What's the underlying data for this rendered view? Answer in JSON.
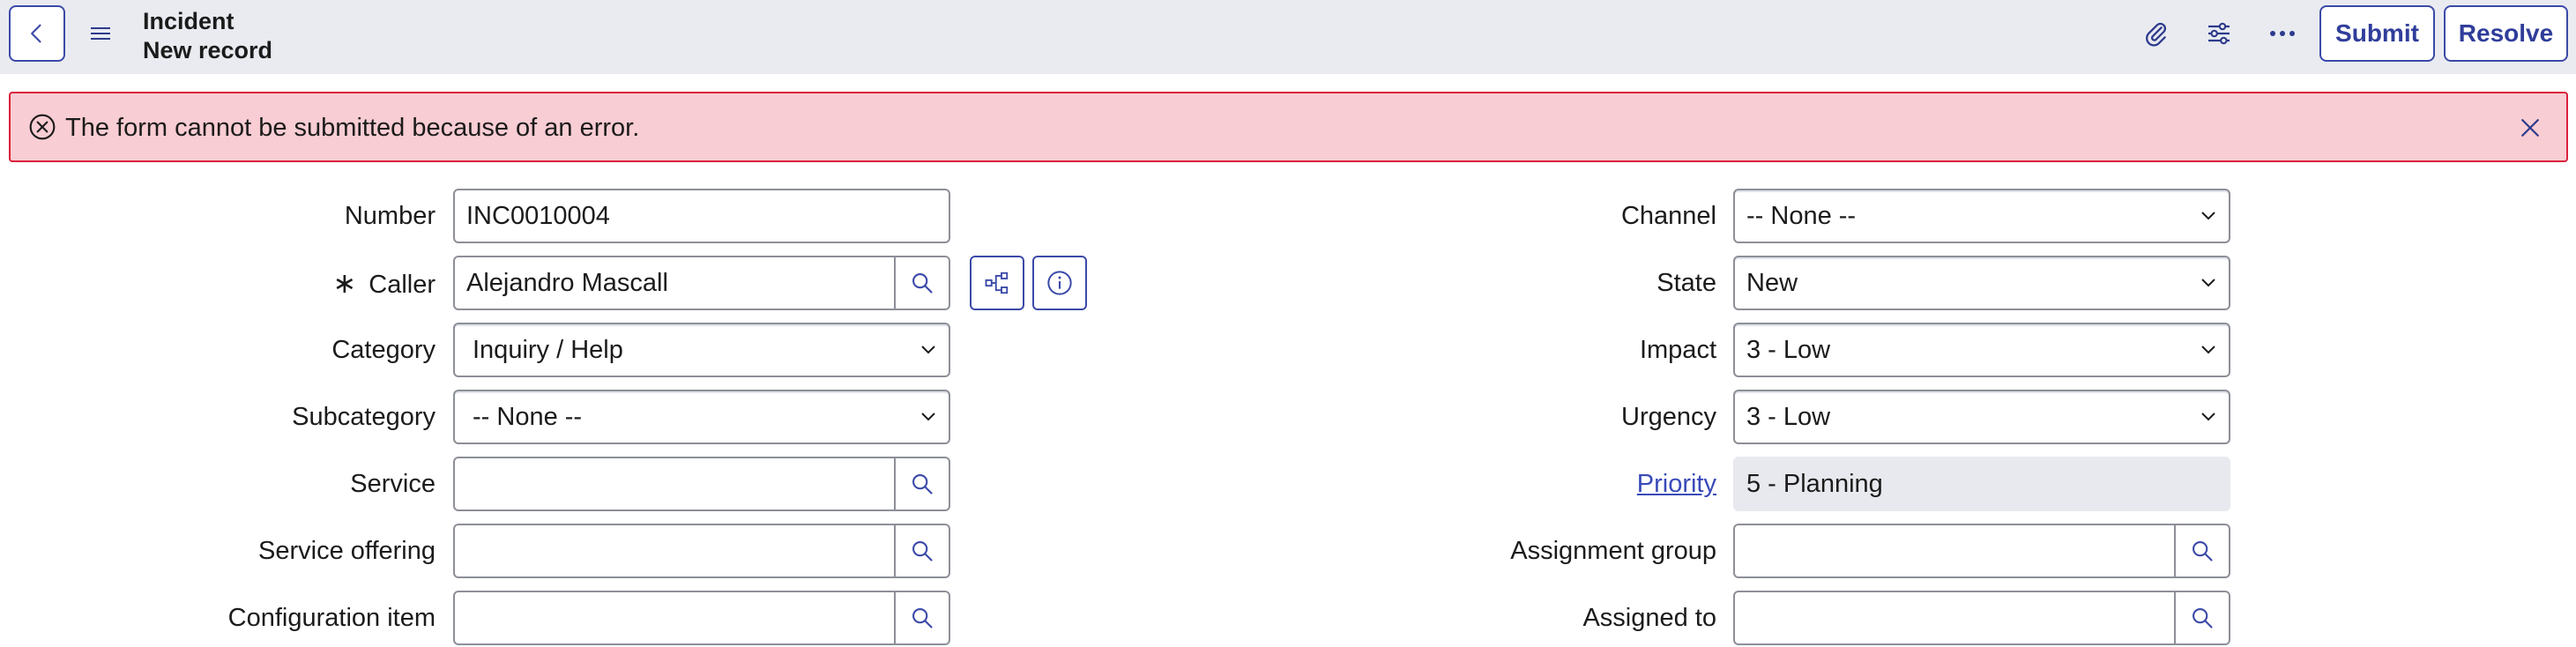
{
  "header": {
    "title": "Incident",
    "subtitle": "New record",
    "submit_label": "Submit",
    "resolve_label": "Resolve"
  },
  "banner": {
    "message": "The form cannot be submitted because of an error."
  },
  "form": {
    "left": {
      "number": {
        "label": "Number",
        "value": "INC0010004"
      },
      "caller": {
        "label": "Caller",
        "value": "Alejandro Mascall",
        "required": true
      },
      "category": {
        "label": "Category",
        "value": "Inquiry / Help"
      },
      "subcategory": {
        "label": "Subcategory",
        "value": "-- None --"
      },
      "service": {
        "label": "Service",
        "value": ""
      },
      "service_offering": {
        "label": "Service offering",
        "value": ""
      },
      "configuration_item": {
        "label": "Configuration item",
        "value": ""
      }
    },
    "right": {
      "channel": {
        "label": "Channel",
        "value": "-- None --"
      },
      "state": {
        "label": "State",
        "value": "New"
      },
      "impact": {
        "label": "Impact",
        "value": "3 - Low"
      },
      "urgency": {
        "label": "Urgency",
        "value": "3 - Low"
      },
      "priority": {
        "label": "Priority",
        "value": "5 - Planning"
      },
      "assignment_group": {
        "label": "Assignment group",
        "value": ""
      },
      "assigned_to": {
        "label": "Assigned to",
        "value": ""
      }
    }
  },
  "colors": {
    "header_bg": "#e9ebf1",
    "accent": "#3b4aa8",
    "error_bg": "#f8cdd3",
    "error_border": "#d9203c",
    "link": "#3a4ab8"
  },
  "icons": {
    "back": "chevron-left-icon",
    "menu": "hamburger-icon",
    "attachment": "paperclip-icon",
    "personalize": "sliders-icon",
    "more": "ellipsis-icon",
    "error": "circle-x-icon",
    "close": "close-icon",
    "lookup": "search-icon",
    "caller_tree": "hierarchy-icon",
    "caller_info": "info-icon"
  }
}
